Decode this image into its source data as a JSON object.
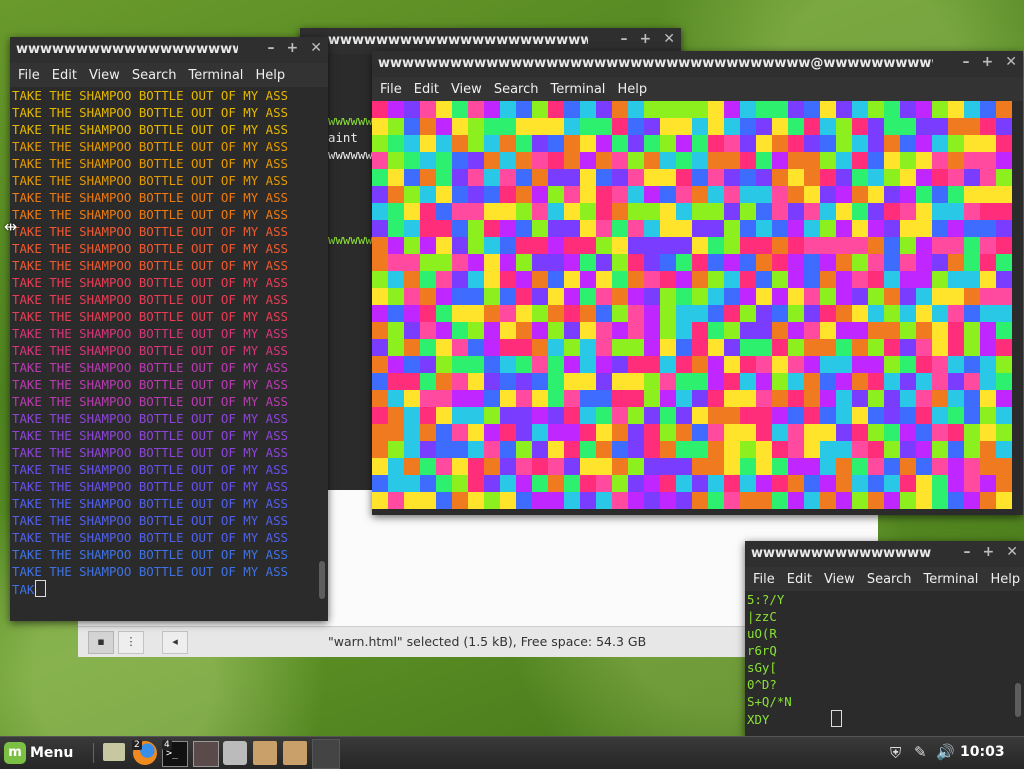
{
  "menu_labels": [
    "File",
    "Edit",
    "View",
    "Search",
    "Terminal",
    "Help"
  ],
  "window_controls": {
    "minimize": "–",
    "maximize": "+",
    "close": "✕"
  },
  "bg_terminal": {
    "title": "wwwwwwwwwwwwwwwwwwwwwwwwwwwwwww@wwwwwwwwwwwwwwwwww",
    "lines": [
      "wwwwww",
      "aint",
      "wwwwww",
      "wwwwww"
    ]
  },
  "left_terminal": {
    "title": "wwwwwwwwwwwwwwwwwwwwww...",
    "repeated_line": "TAKE THE SHAMPOO BOTTLE OUT OF MY ASS",
    "line_count": 29,
    "prompt_text": "TAK",
    "colors": [
      "#e5b800",
      "#e69a00",
      "#ee7a10",
      "#ef5a30",
      "#e83d55",
      "#d6367a",
      "#b83bb0",
      "#8c45d8",
      "#6650ea",
      "#5060ea",
      "#3f72e4"
    ]
  },
  "noise_terminal": {
    "title": "wwwwwwwwwwwwwwwwwwwwwwwwwwwwwwwwwwww@wwwwwwwwwwwwwwwwww...",
    "palette": [
      "#ff2d7a",
      "#29c8e6",
      "#8bf01e",
      "#ffe42b",
      "#3d6cff",
      "#f07a1f",
      "#c026ff",
      "#2cf06e",
      "#ff4aa0",
      "#7a3cff"
    ]
  },
  "small_terminal": {
    "title": "wwwwwwwwwwwwwwwwww...",
    "lines": [
      "5:?/Y",
      "|zzC",
      "uO(R",
      "r6rQ",
      "sGy[",
      "0^D?",
      "S+Q/*N",
      "XDY"
    ]
  },
  "file_manager": {
    "status": "\"warn.html\" selected (1.5 kB), Free space: 54.3 GB"
  },
  "taskbar": {
    "menu_label": "Menu",
    "firefox_badge": "2",
    "terminal_badge": "4",
    "clock": "10:03"
  }
}
